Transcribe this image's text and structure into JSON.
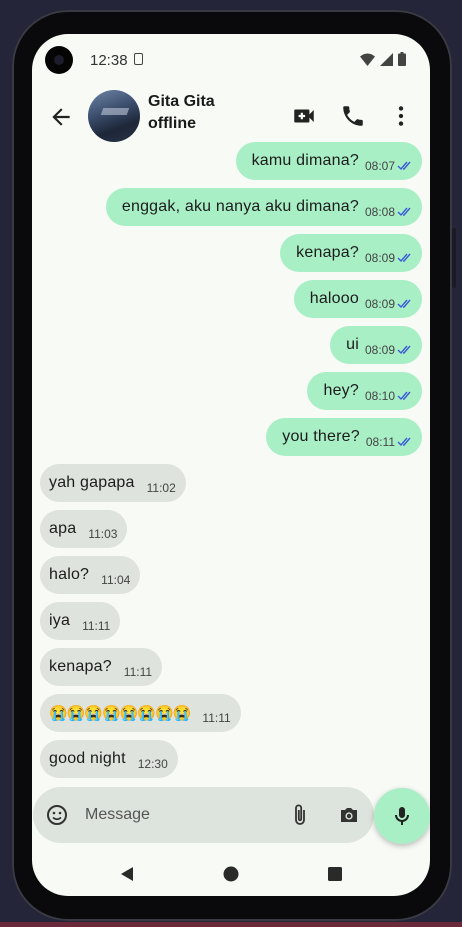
{
  "status_bar": {
    "time": "12:38"
  },
  "header": {
    "contact_name": "Gita Gita",
    "contact_status": "offline"
  },
  "messages": [
    {
      "text": "kamu dimana?",
      "time": "08:07",
      "dir": "out"
    },
    {
      "text": "enggak, aku nanya aku dimana?",
      "time": "08:08",
      "dir": "out"
    },
    {
      "text": "kenapa?",
      "time": "08:09",
      "dir": "out"
    },
    {
      "text": "halooo",
      "time": "08:09",
      "dir": "out"
    },
    {
      "text": "ui",
      "time": "08:09",
      "dir": "out"
    },
    {
      "text": "hey?",
      "time": "08:10",
      "dir": "out"
    },
    {
      "text": "you there?",
      "time": "08:11",
      "dir": "out"
    },
    {
      "text": "yah gapapa",
      "time": "11:02",
      "dir": "in"
    },
    {
      "text": "apa",
      "time": "11:03",
      "dir": "in"
    },
    {
      "text": "halo?",
      "time": "11:04",
      "dir": "in"
    },
    {
      "text": "iya",
      "time": "11:11",
      "dir": "in"
    },
    {
      "text": "kenapa?",
      "time": "11:11",
      "dir": "in"
    },
    {
      "text": "😭😭😭😭😭😭😭😭",
      "time": "11:11",
      "dir": "in"
    },
    {
      "text": "good night",
      "time": "12:30",
      "dir": "in"
    }
  ],
  "composer": {
    "placeholder": "Message"
  },
  "colors": {
    "outgoing": "#a9efc6",
    "incoming": "#dee3dd",
    "read_tick": "#3b5bd9"
  },
  "icons": [
    "back-arrow-icon",
    "video-call-icon",
    "phone-icon",
    "more-vert-icon",
    "emoji-icon",
    "attach-icon",
    "camera-icon",
    "mic-icon",
    "nav-back-icon",
    "nav-home-icon",
    "nav-recents-icon"
  ]
}
